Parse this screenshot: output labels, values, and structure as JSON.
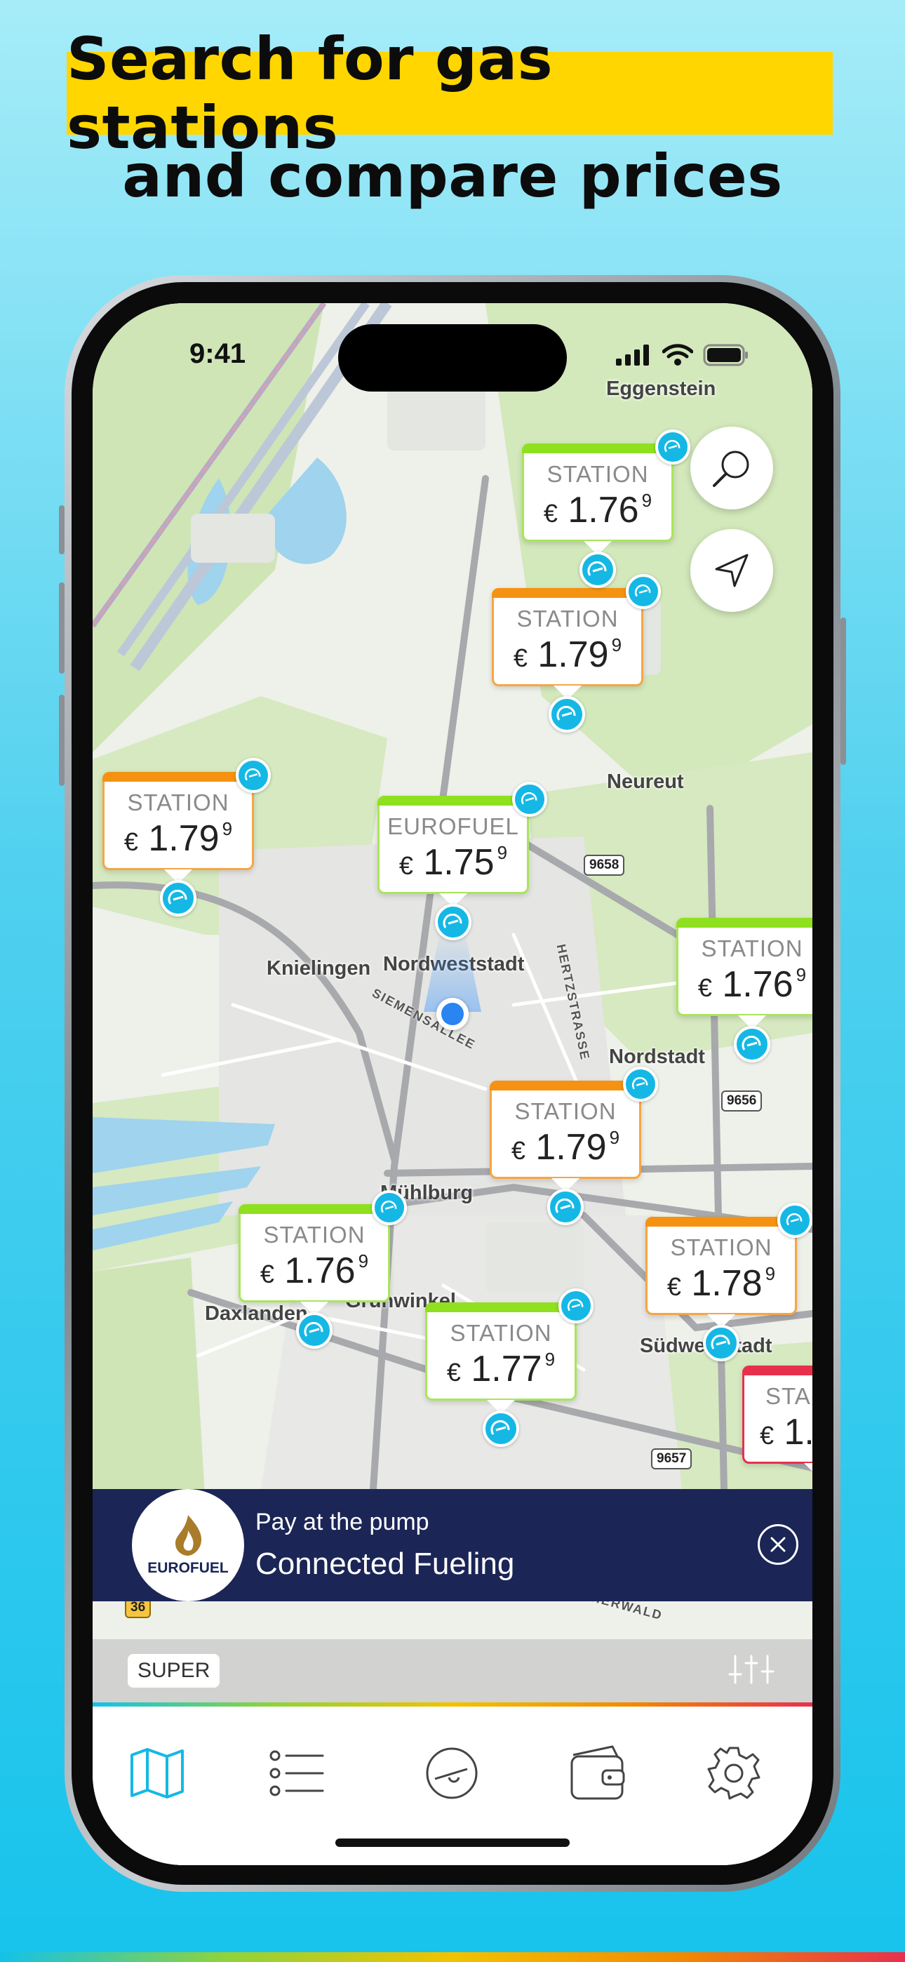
{
  "headline": {
    "line1": "Search for gas stations",
    "line2": "and compare prices"
  },
  "status_bar": {
    "time": "9:41"
  },
  "map_labels": {
    "eggenstein": "Eggenstein",
    "neureut": "Neureut",
    "knielingen": "Knielingen",
    "nordweststadt": "Nordweststadt",
    "nordstadt": "Nordstadt",
    "muhlburg": "Mühlburg",
    "daxlanden": "Daxlanden",
    "grunwinkel": "Grünwinkel",
    "sudweststadt": "Südweststadt",
    "siemensallee": "SIEMENSALLEE",
    "hertzstrasse": "HERTZSTRASSE",
    "weiherwald": "WEIHERWALD",
    "road_9658": "9658",
    "road_9656": "9656",
    "road_9657": "9657",
    "road_36": "36"
  },
  "stations": [
    {
      "name": "STATION",
      "currency": "€",
      "price": "1.76",
      "tenth": "9",
      "status": "green"
    },
    {
      "name": "STATION",
      "currency": "€",
      "price": "1.79",
      "tenth": "9",
      "status": "orange"
    },
    {
      "name": "STATION",
      "currency": "€",
      "price": "1.79",
      "tenth": "9",
      "status": "orange"
    },
    {
      "name": "EUROFUEL",
      "currency": "€",
      "price": "1.75",
      "tenth": "9",
      "status": "green"
    },
    {
      "name": "STATION",
      "currency": "€",
      "price": "1.76",
      "tenth": "9",
      "status": "green"
    },
    {
      "name": "STATION",
      "currency": "€",
      "price": "1.79",
      "tenth": "9",
      "status": "orange"
    },
    {
      "name": "STATION",
      "currency": "€",
      "price": "1.76",
      "tenth": "9",
      "status": "green"
    },
    {
      "name": "STATION",
      "currency": "€",
      "price": "1.78",
      "tenth": "9",
      "status": "orange"
    },
    {
      "name": "STATION",
      "currency": "€",
      "price": "1.77",
      "tenth": "9",
      "status": "green"
    },
    {
      "name": "STA",
      "currency": "€",
      "price": "1.",
      "tenth": "",
      "status": "red"
    }
  ],
  "promo": {
    "logo_text": "EUROFUEL",
    "subtitle": "Pay at the pump",
    "title": "Connected Fueling"
  },
  "filter": {
    "fuel_type": "SUPER"
  },
  "tabs": [
    {
      "icon": "map-icon",
      "active": true
    },
    {
      "icon": "list-icon",
      "active": false
    },
    {
      "icon": "gauge-icon",
      "active": false
    },
    {
      "icon": "wallet-icon",
      "active": false
    },
    {
      "icon": "gear-icon",
      "active": false
    }
  ],
  "colors": {
    "accent": "#15b8e5",
    "green": "#8fe01f",
    "orange": "#f59211",
    "red": "#e8304d",
    "promo_bg": "#1b2556",
    "headline_highlight": "#ffd600"
  }
}
